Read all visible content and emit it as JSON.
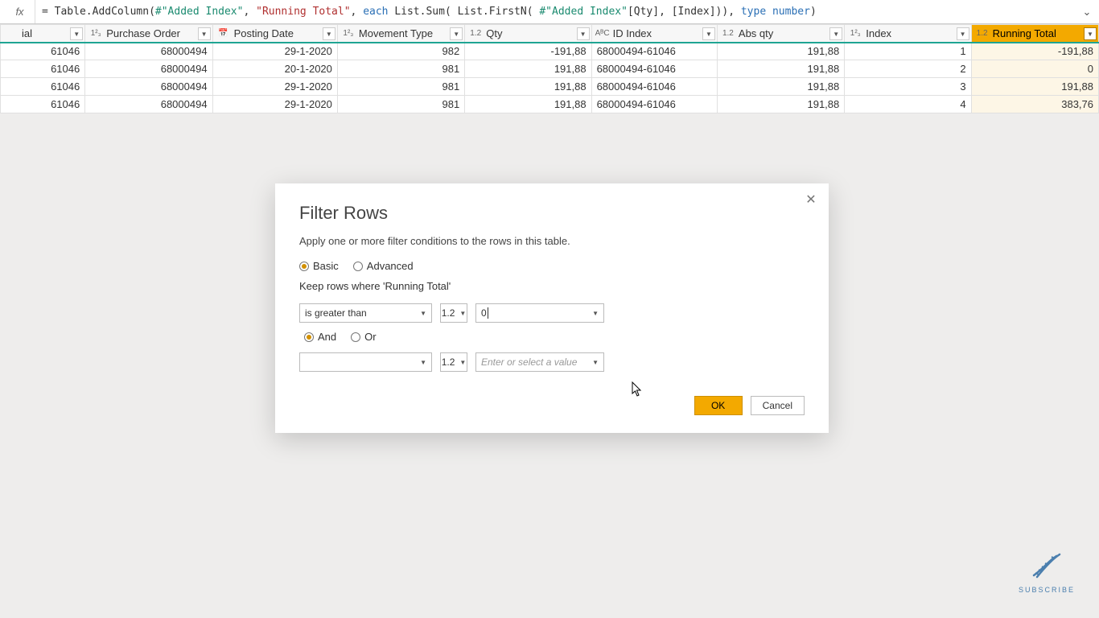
{
  "formula": {
    "prefix": "= ",
    "fn1": "Table.AddColumn",
    "ref1": "#\"Added Index\"",
    "str1": "\"Running Total\"",
    "kw_each": "each",
    "fn2": "List.Sum",
    "fn3": "List.FirstN",
    "ref2": "#\"Added Index\"",
    "col_qty": "[Qty]",
    "col_idx": "[Index]",
    "kw_type": "type number"
  },
  "columns": {
    "ial": {
      "label": "ial",
      "type": ""
    },
    "po": {
      "label": "Purchase Order",
      "type": "1²₃"
    },
    "date": {
      "label": "Posting Date",
      "type": "📅"
    },
    "mov": {
      "label": "Movement Type",
      "type": "1²₃"
    },
    "qty": {
      "label": "Qty",
      "type": "1.2"
    },
    "id": {
      "label": "ID Index",
      "type": "AᴮC"
    },
    "abs": {
      "label": "Abs qty",
      "type": "1.2"
    },
    "idx": {
      "label": "Index",
      "type": "1²₃"
    },
    "run": {
      "label": "Running Total",
      "type": "1.2"
    }
  },
  "rows": [
    {
      "ial": "61046",
      "po": "68000494",
      "date": "29-1-2020",
      "mov": "982",
      "qty": "-191,88",
      "id": "68000494-61046",
      "abs": "191,88",
      "idx": "1",
      "run": "-191,88"
    },
    {
      "ial": "61046",
      "po": "68000494",
      "date": "20-1-2020",
      "mov": "981",
      "qty": "191,88",
      "id": "68000494-61046",
      "abs": "191,88",
      "idx": "2",
      "run": "0"
    },
    {
      "ial": "61046",
      "po": "68000494",
      "date": "29-1-2020",
      "mov": "981",
      "qty": "191,88",
      "id": "68000494-61046",
      "abs": "191,88",
      "idx": "3",
      "run": "191,88"
    },
    {
      "ial": "61046",
      "po": "68000494",
      "date": "29-1-2020",
      "mov": "981",
      "qty": "191,88",
      "id": "68000494-61046",
      "abs": "191,88",
      "idx": "4",
      "run": "383,76"
    }
  ],
  "dialog": {
    "title": "Filter Rows",
    "subtitle": "Apply one or more filter conditions to the rows in this table.",
    "mode_basic": "Basic",
    "mode_advanced": "Advanced",
    "keep_label": "Keep rows where 'Running Total'",
    "op1": "is greater than",
    "type_label": "1.2",
    "val1": "0",
    "and": "And",
    "or": "Or",
    "op2": "",
    "val2_placeholder": "Enter or select a value",
    "ok": "OK",
    "cancel": "Cancel"
  },
  "subscribe": {
    "label": "SUBSCRIBE"
  }
}
